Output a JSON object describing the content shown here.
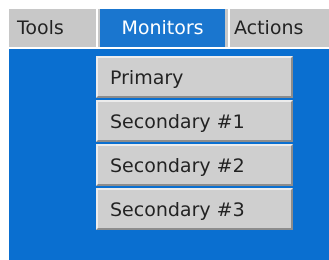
{
  "menubar": {
    "items": [
      {
        "label": "Tools"
      },
      {
        "label": "Monitors"
      },
      {
        "label": "Actions"
      }
    ],
    "active_index": 1
  },
  "dropdown": {
    "items": [
      {
        "label": "Primary"
      },
      {
        "label": "Secondary #1"
      },
      {
        "label": "Secondary #2"
      },
      {
        "label": "Secondary #3"
      }
    ]
  },
  "colors": {
    "menubar_bg": "#c8c8c8",
    "active_item_bg": "#1a76cf",
    "desktop_blue": "#0a6fd0",
    "dropdown_bg": "#cfcfcf"
  }
}
